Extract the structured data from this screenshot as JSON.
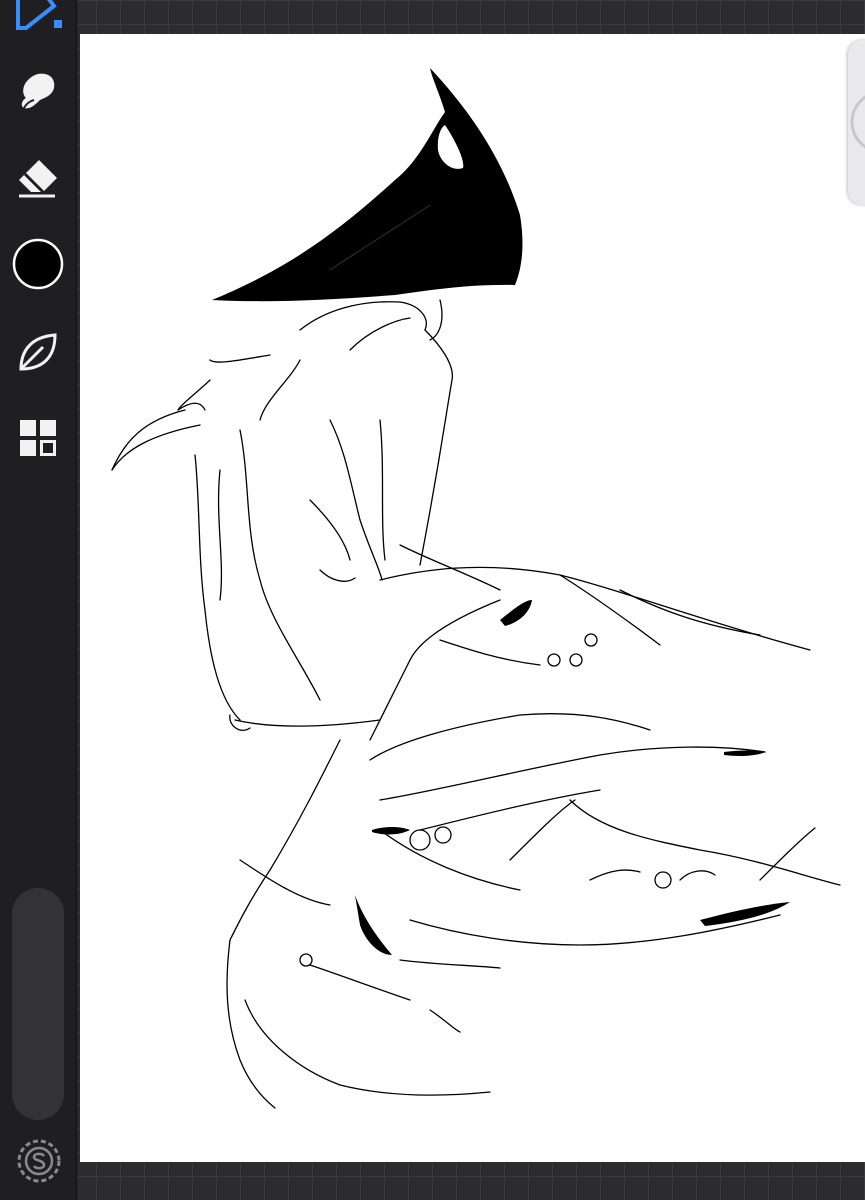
{
  "app": {
    "tools": [
      {
        "name": "brush",
        "icon": "brush-icon",
        "active": true
      },
      {
        "name": "smudge",
        "icon": "smudge-icon"
      },
      {
        "name": "eraser",
        "icon": "eraser-icon"
      },
      {
        "name": "color",
        "icon": "color-swatch",
        "color": "#000000"
      },
      {
        "name": "stabilizer",
        "icon": "leaf-icon"
      },
      {
        "name": "gallery",
        "icon": "grid-icon"
      }
    ],
    "accent": "#3a8dff",
    "canvas_background": "#ffffff",
    "workspace_background": "#2c2c2e",
    "bottom_icon": "s-circle-icon"
  }
}
